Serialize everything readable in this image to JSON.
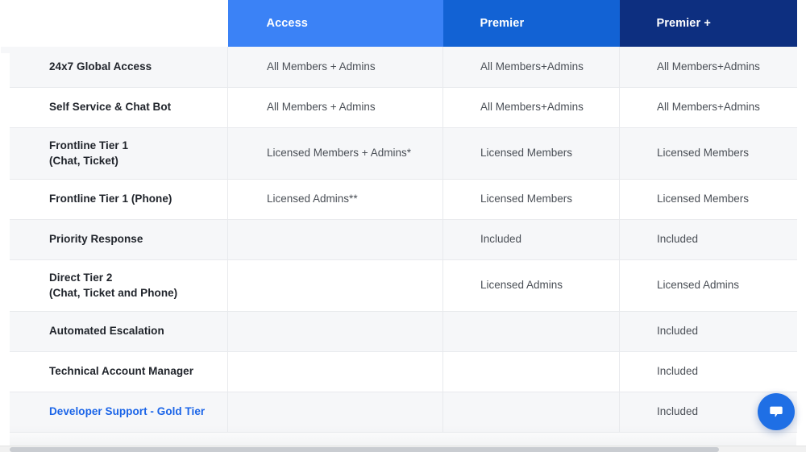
{
  "table": {
    "columns": [
      {
        "key": "feature",
        "label": ""
      },
      {
        "key": "access",
        "label": "Access"
      },
      {
        "key": "premier",
        "label": "Premier"
      },
      {
        "key": "premierplus",
        "label": "Premier +"
      }
    ],
    "header_colors": {
      "access": "#3b82f6",
      "premier": "#1262d4",
      "premierplus": "#0d2f80"
    },
    "rows": [
      {
        "feature": "24x7 Global Access",
        "feature_sub": "",
        "access": "All Members + Admins",
        "premier": "All Members+Admins",
        "premierplus": "All Members+Admins",
        "is_link": false
      },
      {
        "feature": "Self Service & Chat Bot",
        "feature_sub": "",
        "access": "All Members + Admins",
        "premier": "All Members+Admins",
        "premierplus": "All Members+Admins",
        "is_link": false
      },
      {
        "feature": "Frontline Tier 1",
        "feature_sub": "(Chat, Ticket)",
        "access": "Licensed Members + Admins*",
        "premier": "Licensed Members",
        "premierplus": "Licensed Members",
        "is_link": false
      },
      {
        "feature": "Frontline Tier 1 (Phone)",
        "feature_sub": "",
        "access": "Licensed Admins**",
        "premier": "Licensed Members",
        "premierplus": "Licensed Members",
        "is_link": false
      },
      {
        "feature": "Priority Response",
        "feature_sub": "",
        "access": "",
        "premier": "Included",
        "premierplus": "Included",
        "is_link": false
      },
      {
        "feature": "Direct Tier 2",
        "feature_sub": "(Chat, Ticket and Phone)",
        "access": "",
        "premier": "Licensed Admins",
        "premierplus": "Licensed Admins",
        "is_link": false
      },
      {
        "feature": "Automated Escalation",
        "feature_sub": "",
        "access": "",
        "premier": "",
        "premierplus": "Included",
        "is_link": false
      },
      {
        "feature": "Technical Account Manager",
        "feature_sub": "",
        "access": "",
        "premier": "",
        "premierplus": "Included",
        "is_link": false
      },
      {
        "feature": "Developer Support - Gold Tier",
        "feature_sub": "",
        "access": "",
        "premier": "",
        "premierplus": "Included",
        "is_link": true,
        "link_color": "#1a64e8"
      }
    ]
  },
  "chat_widget": {
    "icon": "chat-bubble-icon",
    "color": "#1f6fe5"
  },
  "scrollbar": {
    "orientation": "horizontal"
  }
}
